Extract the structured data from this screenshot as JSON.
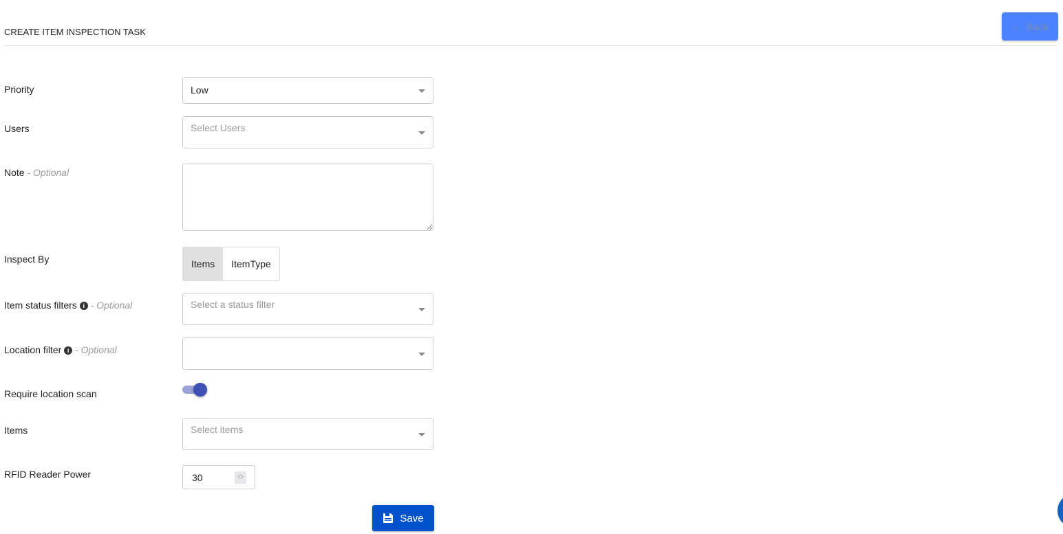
{
  "header": {
    "title": "CREATE ITEM INSPECTION TASK",
    "back_label": "Back"
  },
  "form": {
    "priority": {
      "label": "Priority",
      "value": "Low"
    },
    "users": {
      "label": "Users",
      "placeholder": "Select Users"
    },
    "note": {
      "label": "Note",
      "optional": "- Optional",
      "value": ""
    },
    "inspect_by": {
      "label": "Inspect By",
      "options": [
        "Items",
        "ItemType"
      ],
      "selected": "Items"
    },
    "status_filter": {
      "label": "Item status filters",
      "optional": "- Optional",
      "placeholder": "Select a status filter"
    },
    "location_filter": {
      "label": "Location filter",
      "optional": "- Optional",
      "value": ""
    },
    "require_location_scan": {
      "label": "Require location scan",
      "enabled": true
    },
    "items": {
      "label": "Items",
      "placeholder": "Select items"
    },
    "rfid_power": {
      "label": "RFID Reader Power",
      "value": "30"
    }
  },
  "save_label": "Save",
  "colors": {
    "primary": "#0052cc",
    "back": "#4d82ff",
    "toggle": "#3f51b5"
  }
}
